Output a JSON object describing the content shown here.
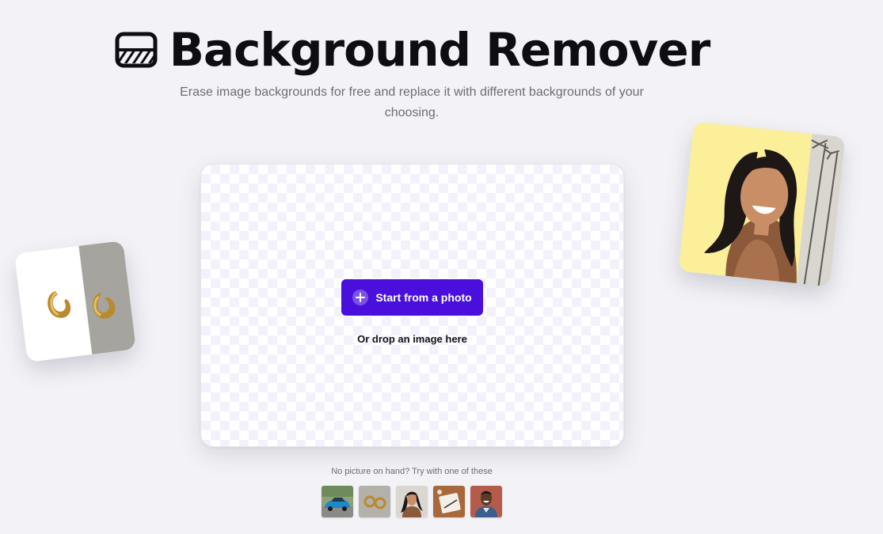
{
  "header": {
    "title": "Background Remover",
    "subtitle": "Erase image backgrounds for free and replace it with different backgrounds of your choosing."
  },
  "dropzone": {
    "start_button_label": "Start from a photo",
    "drop_hint": "Or drop an image here"
  },
  "samples": {
    "label": "No picture on hand? Try with one of these",
    "items": [
      {
        "icon": "car-photo"
      },
      {
        "icon": "earrings-photo"
      },
      {
        "icon": "woman-photo"
      },
      {
        "icon": "notebook-photo"
      },
      {
        "icon": "man-photo"
      }
    ]
  },
  "colors": {
    "accent": "#4a0fdc",
    "background": "#f3f3f7",
    "title": "#0e0e12",
    "muted_text": "#6b6b76"
  }
}
